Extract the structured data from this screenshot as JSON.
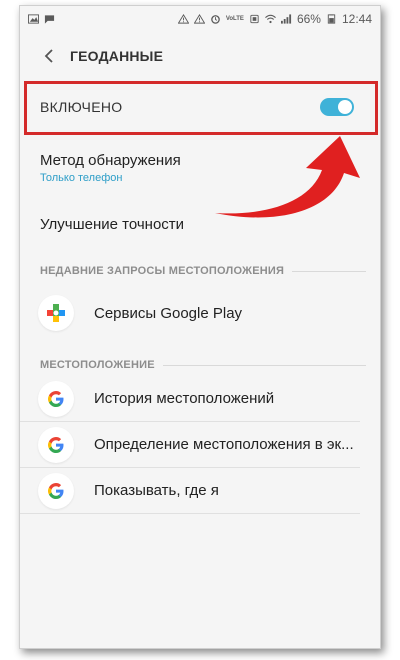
{
  "status_bar": {
    "lte": "VoLTE",
    "battery": "66%",
    "time": "12:44"
  },
  "header": {
    "title": "ГЕОДАННЫЕ"
  },
  "master_switch": {
    "label": "ВКЛЮЧЕНО",
    "on": true
  },
  "settings": {
    "method_title": "Метод обнаружения",
    "method_value": "Только телефон",
    "accuracy_title": "Улучшение точности"
  },
  "recent_section": {
    "title": "НЕДАВНИЕ ЗАПРОСЫ МЕСТОПОЛОЖЕНИЯ",
    "items": [
      {
        "label": "Сервисы Google Play",
        "icon": "google-play-services-icon"
      }
    ]
  },
  "location_section": {
    "title": "МЕСТОПОЛОЖЕНИЕ",
    "items": [
      {
        "label": "История местоположений",
        "icon": "google-g-icon"
      },
      {
        "label": "Определение местоположения в эк...",
        "icon": "google-g-icon"
      },
      {
        "label": "Показывать, где я",
        "icon": "google-g-icon"
      }
    ]
  },
  "colors": {
    "toggle_on": "#3fb2d8",
    "highlight": "#d42a2a",
    "accent_text": "#2e9ec8",
    "arrow": "#e02020"
  }
}
